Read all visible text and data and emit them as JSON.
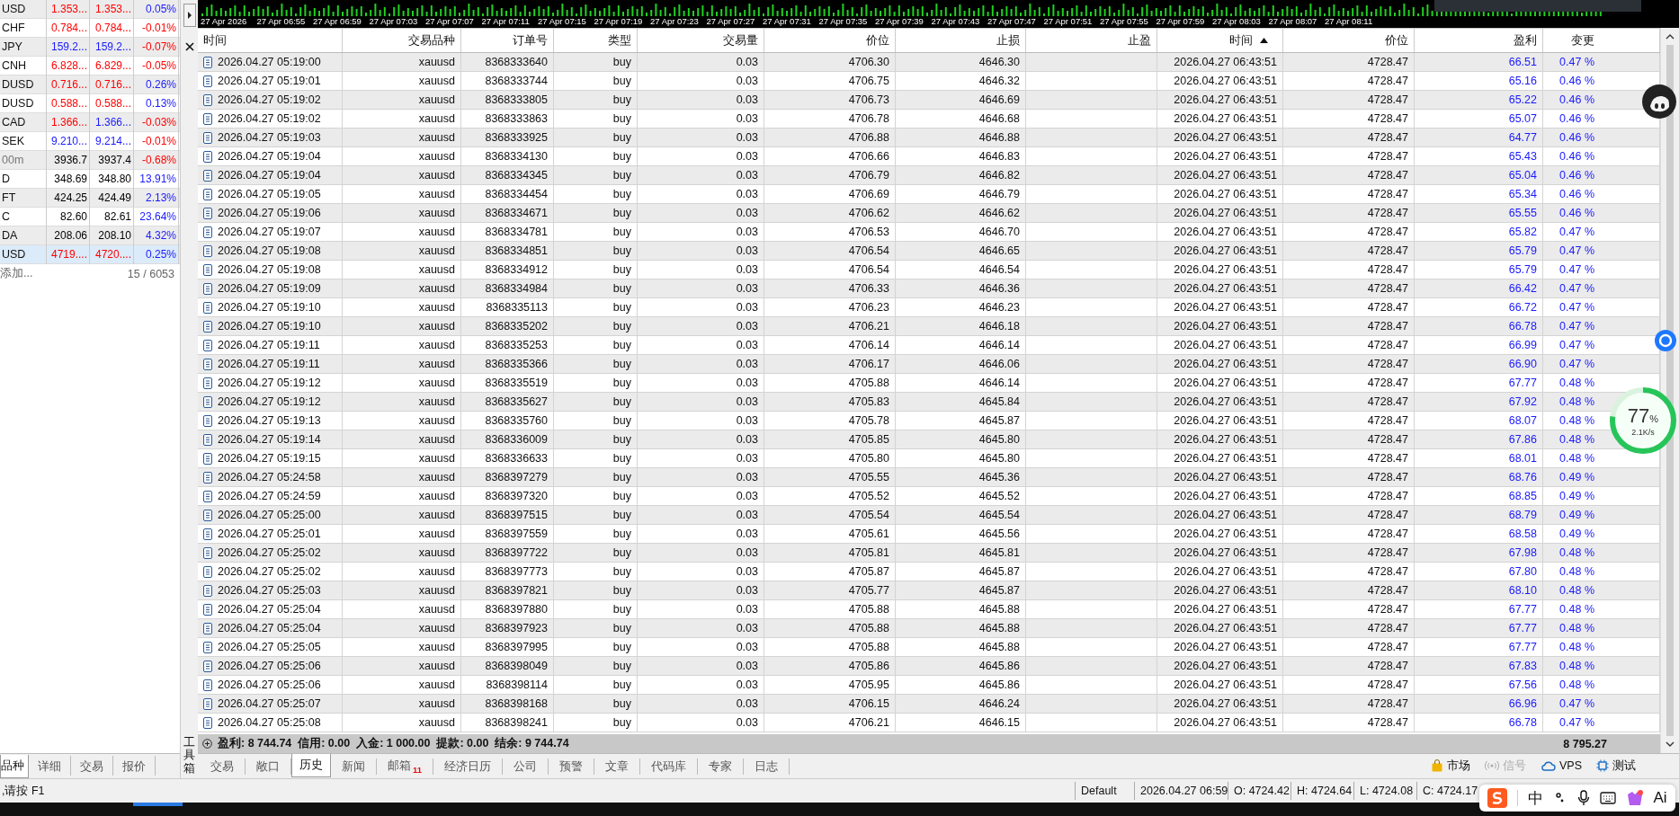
{
  "market_watch": {
    "rows": [
      {
        "symbol": "USD",
        "dimmed": false,
        "bid": {
          "text": "1.353...",
          "color": "#ff0000"
        },
        "ask": {
          "text": "1.353...",
          "color": "#ff0000"
        },
        "change": {
          "text": "0.05%",
          "color": "#1a1aff"
        },
        "selected": false
      },
      {
        "symbol": "CHF",
        "dimmed": false,
        "bid": {
          "text": "0.784...",
          "color": "#ff0000"
        },
        "ask": {
          "text": "0.784...",
          "color": "#ff0000"
        },
        "change": {
          "text": "-0.01%",
          "color": "#ff0000"
        },
        "selected": false
      },
      {
        "symbol": "JPY",
        "dimmed": false,
        "bid": {
          "text": "159.2...",
          "color": "#1a1aff"
        },
        "ask": {
          "text": "159.2...",
          "color": "#1a1aff"
        },
        "change": {
          "text": "-0.07%",
          "color": "#ff0000"
        },
        "selected": false
      },
      {
        "symbol": "CNH",
        "dimmed": false,
        "bid": {
          "text": "6.828...",
          "color": "#ff0000"
        },
        "ask": {
          "text": "6.829...",
          "color": "#ff0000"
        },
        "change": {
          "text": "-0.05%",
          "color": "#ff0000"
        },
        "selected": false
      },
      {
        "symbol": "DUSD",
        "dimmed": false,
        "bid": {
          "text": "0.716...",
          "color": "#ff0000"
        },
        "ask": {
          "text": "0.716...",
          "color": "#ff0000"
        },
        "change": {
          "text": "0.26%",
          "color": "#1a1aff"
        },
        "selected": false
      },
      {
        "symbol": "DUSD",
        "dimmed": false,
        "bid": {
          "text": "0.588...",
          "color": "#ff0000"
        },
        "ask": {
          "text": "0.588...",
          "color": "#ff0000"
        },
        "change": {
          "text": "0.13%",
          "color": "#1a1aff"
        },
        "selected": false
      },
      {
        "symbol": "CAD",
        "dimmed": false,
        "bid": {
          "text": "1.366...",
          "color": "#ff0000"
        },
        "ask": {
          "text": "1.366...",
          "color": "#1a1aff"
        },
        "change": {
          "text": "-0.03%",
          "color": "#ff0000"
        },
        "selected": false
      },
      {
        "symbol": "SEK",
        "dimmed": false,
        "bid": {
          "text": "9.210...",
          "color": "#1a1aff"
        },
        "ask": {
          "text": "9.214...",
          "color": "#1a1aff"
        },
        "change": {
          "text": "-0.01%",
          "color": "#ff0000"
        },
        "selected": false
      },
      {
        "symbol": "00m",
        "dimmed": true,
        "bid": {
          "text": "3936.7",
          "color": "#000000"
        },
        "ask": {
          "text": "3937.4",
          "color": "#000000"
        },
        "change": {
          "text": "-0.68%",
          "color": "#ff0000"
        },
        "selected": false
      },
      {
        "symbol": "D",
        "dimmed": false,
        "bid": {
          "text": "348.69",
          "color": "#000000"
        },
        "ask": {
          "text": "348.80",
          "color": "#000000"
        },
        "change": {
          "text": "13.91%",
          "color": "#1a1aff"
        },
        "selected": false
      },
      {
        "symbol": "FT",
        "dimmed": false,
        "bid": {
          "text": "424.25",
          "color": "#000000"
        },
        "ask": {
          "text": "424.49",
          "color": "#000000"
        },
        "change": {
          "text": "2.13%",
          "color": "#1a1aff"
        },
        "selected": false
      },
      {
        "symbol": "C",
        "dimmed": false,
        "bid": {
          "text": "82.60",
          "color": "#000000"
        },
        "ask": {
          "text": "82.61",
          "color": "#000000"
        },
        "change": {
          "text": "23.64%",
          "color": "#1a1aff"
        },
        "selected": false
      },
      {
        "symbol": "DA",
        "dimmed": false,
        "bid": {
          "text": "208.06",
          "color": "#000000"
        },
        "ask": {
          "text": "208.10",
          "color": "#000000"
        },
        "change": {
          "text": "4.32%",
          "color": "#1a1aff"
        },
        "selected": false
      },
      {
        "symbol": "USD",
        "dimmed": false,
        "bid": {
          "text": "4719....",
          "color": "#ff0000"
        },
        "ask": {
          "text": "4720....",
          "color": "#ff0000"
        },
        "change": {
          "text": "0.25%",
          "color": "#1a1aff"
        },
        "selected": true
      }
    ],
    "add_placeholder": "添加...",
    "count": "15 / 6053",
    "tabs": [
      {
        "label": "品种",
        "selected": true
      },
      {
        "label": "详细",
        "selected": false
      },
      {
        "label": "交易",
        "selected": false
      },
      {
        "label": "报价",
        "selected": false
      }
    ]
  },
  "toolbox_label": "工具箱",
  "chart": {
    "time_labels": [
      "27 Apr 2026",
      "27 Apr 06:55",
      "27 Apr 06:59",
      "27 Apr 07:03",
      "27 Apr 07:07",
      "27 Apr 07:11",
      "27 Apr 07:15",
      "27 Apr 07:19",
      "27 Apr 07:23",
      "27 Apr 07:27",
      "27 Apr 07:31",
      "27 Apr 07:35",
      "27 Apr 07:39",
      "27 Apr 07:43",
      "27 Apr 07:47",
      "27 Apr 07:51",
      "27 Apr 07:55",
      "27 Apr 07:59",
      "27 Apr 08:03",
      "27 Apr 08:07",
      "27 Apr 08:11"
    ]
  },
  "history": {
    "columns": [
      {
        "label": "时间",
        "sorted": false
      },
      {
        "label": "交易品种",
        "sorted": false
      },
      {
        "label": "订单号",
        "sorted": false
      },
      {
        "label": "类型",
        "sorted": false
      },
      {
        "label": "交易量",
        "sorted": false
      },
      {
        "label": "价位",
        "sorted": false
      },
      {
        "label": "止损",
        "sorted": false
      },
      {
        "label": "止盈",
        "sorted": false
      },
      {
        "label": "时间",
        "sorted": true
      },
      {
        "label": "价位",
        "sorted": false
      },
      {
        "label": "盈利",
        "sorted": false
      },
      {
        "label": "变更",
        "sorted": false
      }
    ],
    "rows": [
      [
        "2026.04.27 05:19:00",
        "xauusd",
        "8368333640",
        "buy",
        "0.03",
        "4706.30",
        "4646.30",
        "",
        "2026.04.27 06:43:51",
        "4728.47",
        "66.51",
        "0.47 %"
      ],
      [
        "2026.04.27 05:19:01",
        "xauusd",
        "8368333744",
        "buy",
        "0.03",
        "4706.75",
        "4646.32",
        "",
        "2026.04.27 06:43:51",
        "4728.47",
        "65.16",
        "0.46 %"
      ],
      [
        "2026.04.27 05:19:02",
        "xauusd",
        "8368333805",
        "buy",
        "0.03",
        "4706.73",
        "4646.69",
        "",
        "2026.04.27 06:43:51",
        "4728.47",
        "65.22",
        "0.46 %"
      ],
      [
        "2026.04.27 05:19:02",
        "xauusd",
        "8368333863",
        "buy",
        "0.03",
        "4706.78",
        "4646.68",
        "",
        "2026.04.27 06:43:51",
        "4728.47",
        "65.07",
        "0.46 %"
      ],
      [
        "2026.04.27 05:19:03",
        "xauusd",
        "8368333925",
        "buy",
        "0.03",
        "4706.88",
        "4646.88",
        "",
        "2026.04.27 06:43:51",
        "4728.47",
        "64.77",
        "0.46 %"
      ],
      [
        "2026.04.27 05:19:04",
        "xauusd",
        "8368334130",
        "buy",
        "0.03",
        "4706.66",
        "4646.83",
        "",
        "2026.04.27 06:43:51",
        "4728.47",
        "65.43",
        "0.46 %"
      ],
      [
        "2026.04.27 05:19:04",
        "xauusd",
        "8368334345",
        "buy",
        "0.03",
        "4706.79",
        "4646.82",
        "",
        "2026.04.27 06:43:51",
        "4728.47",
        "65.04",
        "0.46 %"
      ],
      [
        "2026.04.27 05:19:05",
        "xauusd",
        "8368334454",
        "buy",
        "0.03",
        "4706.69",
        "4646.79",
        "",
        "2026.04.27 06:43:51",
        "4728.47",
        "65.34",
        "0.46 %"
      ],
      [
        "2026.04.27 05:19:06",
        "xauusd",
        "8368334671",
        "buy",
        "0.03",
        "4706.62",
        "4646.62",
        "",
        "2026.04.27 06:43:51",
        "4728.47",
        "65.55",
        "0.46 %"
      ],
      [
        "2026.04.27 05:19:07",
        "xauusd",
        "8368334781",
        "buy",
        "0.03",
        "4706.53",
        "4646.70",
        "",
        "2026.04.27 06:43:51",
        "4728.47",
        "65.82",
        "0.47 %"
      ],
      [
        "2026.04.27 05:19:08",
        "xauusd",
        "8368334851",
        "buy",
        "0.03",
        "4706.54",
        "4646.65",
        "",
        "2026.04.27 06:43:51",
        "4728.47",
        "65.79",
        "0.47 %"
      ],
      [
        "2026.04.27 05:19:08",
        "xauusd",
        "8368334912",
        "buy",
        "0.03",
        "4706.54",
        "4646.54",
        "",
        "2026.04.27 06:43:51",
        "4728.47",
        "65.79",
        "0.47 %"
      ],
      [
        "2026.04.27 05:19:09",
        "xauusd",
        "8368334984",
        "buy",
        "0.03",
        "4706.33",
        "4646.36",
        "",
        "2026.04.27 06:43:51",
        "4728.47",
        "66.42",
        "0.47 %"
      ],
      [
        "2026.04.27 05:19:10",
        "xauusd",
        "8368335113",
        "buy",
        "0.03",
        "4706.23",
        "4646.23",
        "",
        "2026.04.27 06:43:51",
        "4728.47",
        "66.72",
        "0.47 %"
      ],
      [
        "2026.04.27 05:19:10",
        "xauusd",
        "8368335202",
        "buy",
        "0.03",
        "4706.21",
        "4646.18",
        "",
        "2026.04.27 06:43:51",
        "4728.47",
        "66.78",
        "0.47 %"
      ],
      [
        "2026.04.27 05:19:11",
        "xauusd",
        "8368335253",
        "buy",
        "0.03",
        "4706.14",
        "4646.14",
        "",
        "2026.04.27 06:43:51",
        "4728.47",
        "66.99",
        "0.47 %"
      ],
      [
        "2026.04.27 05:19:11",
        "xauusd",
        "8368335366",
        "buy",
        "0.03",
        "4706.17",
        "4646.06",
        "",
        "2026.04.27 06:43:51",
        "4728.47",
        "66.90",
        "0.47 %"
      ],
      [
        "2026.04.27 05:19:12",
        "xauusd",
        "8368335519",
        "buy",
        "0.03",
        "4705.88",
        "4646.14",
        "",
        "2026.04.27 06:43:51",
        "4728.47",
        "67.77",
        "0.48 %"
      ],
      [
        "2026.04.27 05:19:12",
        "xauusd",
        "8368335627",
        "buy",
        "0.03",
        "4705.83",
        "4645.84",
        "",
        "2026.04.27 06:43:51",
        "4728.47",
        "67.92",
        "0.48 %"
      ],
      [
        "2026.04.27 05:19:13",
        "xauusd",
        "8368335760",
        "buy",
        "0.03",
        "4705.78",
        "4645.87",
        "",
        "2026.04.27 06:43:51",
        "4728.47",
        "68.07",
        "0.48 %"
      ],
      [
        "2026.04.27 05:19:14",
        "xauusd",
        "8368336009",
        "buy",
        "0.03",
        "4705.85",
        "4645.80",
        "",
        "2026.04.27 06:43:51",
        "4728.47",
        "67.86",
        "0.48 %"
      ],
      [
        "2026.04.27 05:19:15",
        "xauusd",
        "8368336633",
        "buy",
        "0.03",
        "4705.80",
        "4645.80",
        "",
        "2026.04.27 06:43:51",
        "4728.47",
        "68.01",
        "0.48 %"
      ],
      [
        "2026.04.27 05:24:58",
        "xauusd",
        "8368397279",
        "buy",
        "0.03",
        "4705.55",
        "4645.36",
        "",
        "2026.04.27 06:43:51",
        "4728.47",
        "68.76",
        "0.49 %"
      ],
      [
        "2026.04.27 05:24:59",
        "xauusd",
        "8368397320",
        "buy",
        "0.03",
        "4705.52",
        "4645.52",
        "",
        "2026.04.27 06:43:51",
        "4728.47",
        "68.85",
        "0.49 %"
      ],
      [
        "2026.04.27 05:25:00",
        "xauusd",
        "8368397515",
        "buy",
        "0.03",
        "4705.54",
        "4645.54",
        "",
        "2026.04.27 06:43:51",
        "4728.47",
        "68.79",
        "0.49 %"
      ],
      [
        "2026.04.27 05:25:01",
        "xauusd",
        "8368397559",
        "buy",
        "0.03",
        "4705.61",
        "4645.56",
        "",
        "2026.04.27 06:43:51",
        "4728.47",
        "68.58",
        "0.49 %"
      ],
      [
        "2026.04.27 05:25:02",
        "xauusd",
        "8368397722",
        "buy",
        "0.03",
        "4705.81",
        "4645.81",
        "",
        "2026.04.27 06:43:51",
        "4728.47",
        "67.98",
        "0.48 %"
      ],
      [
        "2026.04.27 05:25:02",
        "xauusd",
        "8368397773",
        "buy",
        "0.03",
        "4705.87",
        "4645.87",
        "",
        "2026.04.27 06:43:51",
        "4728.47",
        "67.80",
        "0.48 %"
      ],
      [
        "2026.04.27 05:25:03",
        "xauusd",
        "8368397821",
        "buy",
        "0.03",
        "4705.77",
        "4645.87",
        "",
        "2026.04.27 06:43:51",
        "4728.47",
        "68.10",
        "0.48 %"
      ],
      [
        "2026.04.27 05:25:04",
        "xauusd",
        "8368397880",
        "buy",
        "0.03",
        "4705.88",
        "4645.88",
        "",
        "2026.04.27 06:43:51",
        "4728.47",
        "67.77",
        "0.48 %"
      ],
      [
        "2026.04.27 05:25:04",
        "xauusd",
        "8368397923",
        "buy",
        "0.03",
        "4705.88",
        "4645.88",
        "",
        "2026.04.27 06:43:51",
        "4728.47",
        "67.77",
        "0.48 %"
      ],
      [
        "2026.04.27 05:25:05",
        "xauusd",
        "8368397995",
        "buy",
        "0.03",
        "4705.88",
        "4645.88",
        "",
        "2026.04.27 06:43:51",
        "4728.47",
        "67.77",
        "0.48 %"
      ],
      [
        "2026.04.27 05:25:06",
        "xauusd",
        "8368398049",
        "buy",
        "0.03",
        "4705.86",
        "4645.86",
        "",
        "2026.04.27 06:43:51",
        "4728.47",
        "67.83",
        "0.48 %"
      ],
      [
        "2026.04.27 05:25:06",
        "xauusd",
        "8368398114",
        "buy",
        "0.03",
        "4705.95",
        "4645.86",
        "",
        "2026.04.27 06:43:51",
        "4728.47",
        "67.56",
        "0.48 %"
      ],
      [
        "2026.04.27 05:25:07",
        "xauusd",
        "8368398168",
        "buy",
        "0.03",
        "4706.15",
        "4646.24",
        "",
        "2026.04.27 06:43:51",
        "4728.47",
        "66.96",
        "0.47 %"
      ],
      [
        "2026.04.27 05:25:08",
        "xauusd",
        "8368398241",
        "buy",
        "0.03",
        "4706.21",
        "4646.15",
        "",
        "2026.04.27 06:43:51",
        "4728.47",
        "66.78",
        "0.47 %"
      ]
    ],
    "summary": "盈利: 8 744.74  信用: 0.00  入金: 1 000.00  提款: 0.00  结余: 9 744.74",
    "total_profit": "8 795.27"
  },
  "tabs": [
    {
      "label": "交易",
      "selected": false
    },
    {
      "label": "敞口",
      "selected": false
    },
    {
      "label": "历史",
      "selected": true
    },
    {
      "label": "新闻",
      "selected": false
    },
    {
      "label": "邮箱",
      "selected": false,
      "badge": "11"
    },
    {
      "label": "经济日历",
      "selected": false
    },
    {
      "label": "公司",
      "selected": false
    },
    {
      "label": "预警",
      "selected": false
    },
    {
      "label": "文章",
      "selected": false
    },
    {
      "label": "代码库",
      "selected": false
    },
    {
      "label": "专家",
      "selected": false
    },
    {
      "label": "日志",
      "selected": false
    }
  ],
  "tools": [
    {
      "kind": "market",
      "label": "市场",
      "disabled": false
    },
    {
      "kind": "signal",
      "label": "信号",
      "disabled": true
    },
    {
      "kind": "vps",
      "label": "VPS",
      "disabled": false
    },
    {
      "kind": "test",
      "label": "测试",
      "disabled": false
    }
  ],
  "status": {
    "hint": ",请按 F1",
    "segments": [
      "Default",
      "2026.04.27 06:59",
      "O: 4724.42",
      "H: 4724.64",
      "L: 4724.08",
      "C: 4724.17"
    ]
  },
  "net_meter": {
    "percent": "77",
    "unit": "%",
    "speed": "2.1K/s",
    "level": 0.77
  },
  "ime": {
    "language": "中",
    "ai": "Ai"
  }
}
